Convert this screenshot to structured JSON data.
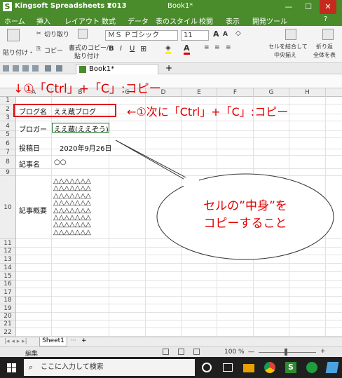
{
  "titlebar": {
    "app_icon": "S",
    "app_name": "Kingsoft Spreadsheets 2013",
    "dropdown": "▼",
    "doc_title": "Book1*",
    "minimize": "—",
    "maximize": "☐",
    "close": "✕"
  },
  "menu": [
    "ホーム",
    "挿入",
    "レイアウト",
    "数式",
    "データ",
    "表のスタイル",
    "校閲",
    "表示",
    "開発ツール",
    "?"
  ],
  "ribbon": {
    "paste": "貼り付け・",
    "cut": "切り取り",
    "copy": "コピー",
    "format_copy": "書式のコピー/",
    "format_copy2": "貼り付け",
    "font_name": "ＭＳ Ｐゴシック",
    "font_size": "11",
    "merge1": "セルを結合して",
    "merge2": "中央揃え",
    "wrap1": "折り返",
    "wrap2": "全体を表"
  },
  "qat": {
    "tab": "Book1*",
    "plus": "+"
  },
  "columns": [
    "A",
    "B",
    "C",
    "D",
    "E",
    "F",
    "G",
    "H"
  ],
  "rows": [
    "1",
    "2",
    "3",
    "4",
    "5",
    "6",
    "7",
    "8",
    "9",
    "10",
    "11",
    "12",
    "13",
    "14",
    "15",
    "16",
    "17",
    "18",
    "19",
    "20",
    "21",
    "22"
  ],
  "cells": {
    "a2": "ブログ名",
    "b2": "ええ蔵ブログ",
    "a4": "ブロガー",
    "b4": "ええ蔵(ええぞう)",
    "a6": "投稿日",
    "b6": "2020年9月26日",
    "a8": "記事名",
    "b8": "○○",
    "a10": "記事概要",
    "b10": "△△△△△△△\n△△△△△△△\n△△△△△△△\n△△△△△△△\n△△△△△△△\n△△△△△△△\n△△△△△△△\n△△△△△△△"
  },
  "annotations": {
    "top": "↓①「Ctrl」+「C」:コピー",
    "right": "←①次に「Ctrl」+「C」:コピー",
    "bubble": "セルの”中身”を\nコピーすること",
    "color": "#e00000"
  },
  "sheettabs": {
    "sheet": "Sheet1",
    "more": "···",
    "add": "+"
  },
  "status": {
    "mode": "編集",
    "zoom": "100 %",
    "minus": "—",
    "plus": "+"
  },
  "taskbar": {
    "search": "ここに入力して検索"
  }
}
